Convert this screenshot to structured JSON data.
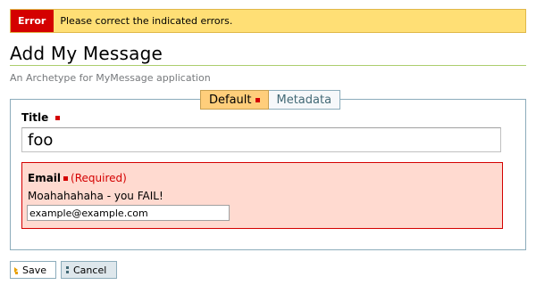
{
  "error_banner": {
    "badge": "Error",
    "message": "Please correct the indicated errors."
  },
  "header": {
    "title": "Add My Message",
    "description": "An Archetype for MyMessage application"
  },
  "tabs": [
    {
      "label": "Default",
      "active": true,
      "has_required": true
    },
    {
      "label": "Metadata",
      "active": false,
      "has_required": false
    }
  ],
  "fields": {
    "title": {
      "label": "Title",
      "value": "foo"
    },
    "email": {
      "label": "Email",
      "required_text": "(Required)",
      "error_message": "Moahahahaha - you FAIL!",
      "value": "example@example.com"
    }
  },
  "buttons": {
    "save_label": "Save",
    "cancel_label": "Cancel"
  },
  "colors": {
    "error_red": "#d40000",
    "banner_yellow": "#ffdf75",
    "active_tab": "#ffce7b",
    "error_field_bg": "#ffdad0",
    "border_blue": "#8cacbb"
  }
}
